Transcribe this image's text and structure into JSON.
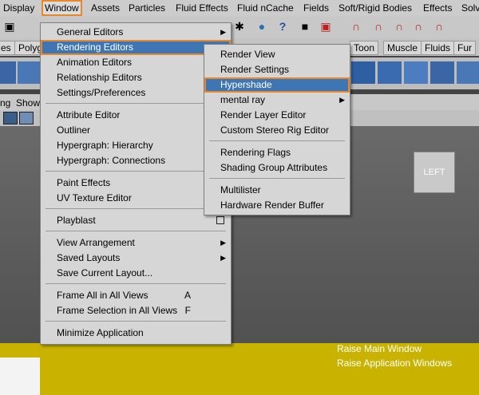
{
  "menubar": {
    "items": [
      "Display",
      "Window",
      "Assets",
      "Particles",
      "Fluid Effects",
      "Fluid nCache",
      "Fields",
      "Soft/Rigid Bodies",
      "Effects",
      "Solv"
    ]
  },
  "shelf": {
    "tabs": [
      "Polyg",
      "Toon",
      "Muscle",
      "Fluids",
      "Fur"
    ]
  },
  "viewport_menu": {
    "items": [
      "ng",
      "Show"
    ]
  },
  "viewcube": {
    "label": "LEFT"
  },
  "window_menu": {
    "items": [
      "General Editors",
      "Rendering Editors",
      "Animation Editors",
      "Relationship Editors",
      "Settings/Preferences",
      "Attribute Editor",
      "Outliner",
      "Hypergraph: Hierarchy",
      "Hypergraph: Connections",
      "Paint Effects",
      "UV Texture Editor",
      "Playblast",
      "View Arrangement",
      "Saved Layouts",
      "Save Current Layout...",
      "Frame All in All Views",
      "Frame Selection in All Views",
      "Minimize Application"
    ],
    "accels": {
      "frame_all": "A",
      "frame_selection": "F"
    }
  },
  "rendering_submenu": {
    "items": [
      "Render View",
      "Render Settings",
      "Hypershade",
      "mental ray",
      "Render Layer Editor",
      "Custom Stereo Rig Editor",
      "Rendering Flags",
      "Shading Group Attributes",
      "Multilister",
      "Hardware Render Buffer"
    ]
  },
  "status_messages": [
    "Raise Main Window",
    "Raise Application Windows"
  ],
  "colors": {
    "highlight": "#3e76b4",
    "outline": "#e8872c",
    "yellow": "#c9b300"
  },
  "icons": [
    "save-icon",
    "magnet-icon",
    "sphere-icon",
    "help-icon",
    "lock-icon"
  ]
}
